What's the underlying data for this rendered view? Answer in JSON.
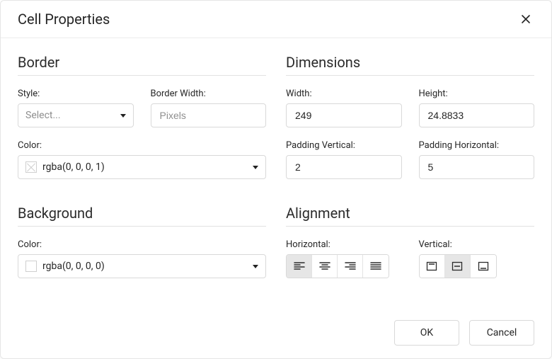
{
  "dialog": {
    "title": "Cell Properties"
  },
  "border": {
    "section_title": "Border",
    "style_label": "Style:",
    "style_placeholder": "Select...",
    "width_label": "Border Width:",
    "width_placeholder": "Pixels",
    "color_label": "Color:",
    "color_value": "rgba(0, 0, 0, 1)"
  },
  "background": {
    "section_title": "Background",
    "color_label": "Color:",
    "color_value": "rgba(0, 0, 0, 0)"
  },
  "dimensions": {
    "section_title": "Dimensions",
    "width_label": "Width:",
    "width_value": "249",
    "height_label": "Height:",
    "height_value": "24.8833",
    "padding_v_label": "Padding Vertical:",
    "padding_v_value": "2",
    "padding_h_label": "Padding Horizontal:",
    "padding_h_value": "5"
  },
  "alignment": {
    "section_title": "Alignment",
    "horizontal_label": "Horizontal:",
    "vertical_label": "Vertical:",
    "horizontal_selected": "left",
    "vertical_selected": "middle"
  },
  "footer": {
    "ok_label": "OK",
    "cancel_label": "Cancel"
  }
}
